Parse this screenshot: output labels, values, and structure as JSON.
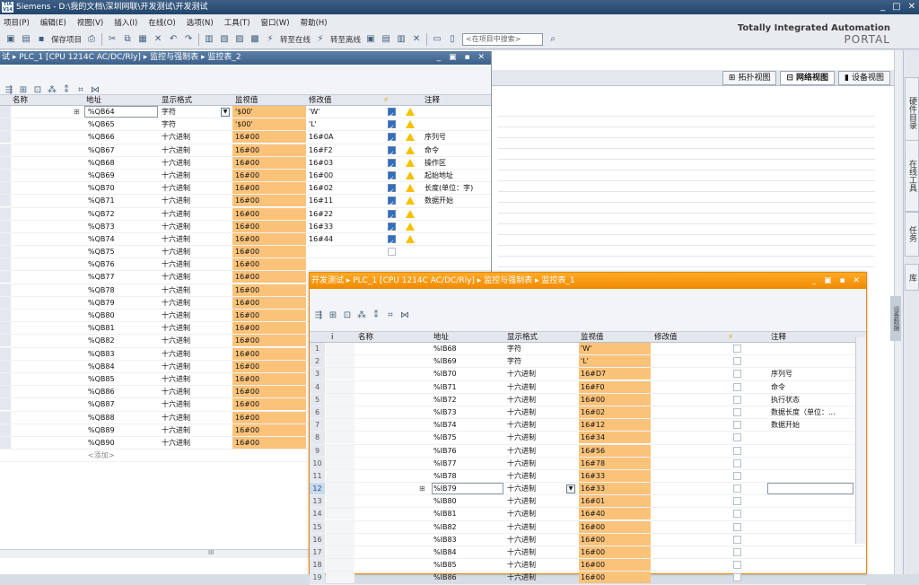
{
  "app": {
    "title": "Siemens  -  D:\\我的文档\\深圳网联\\开发测试\\开发测试",
    "logo": "TIA V14"
  },
  "menu": [
    "项目(P)",
    "编辑(E)",
    "视图(V)",
    "插入(I)",
    "在线(O)",
    "选项(N)",
    "工具(T)",
    "窗口(W)",
    "帮助(H)"
  ],
  "toolbar": {
    "save_project": "保存项目",
    "go_online": "转至在线",
    "go_offline": "转至离线",
    "search_placeholder": "<在项目中搜索>"
  },
  "brand": {
    "line1": "Totally Integrated Automation",
    "line2": "PORTAL"
  },
  "views": [
    "拓扑视图",
    "网络视图",
    "设备视图"
  ],
  "side_tabs": [
    "硬件目录",
    "在线工具",
    "任务",
    "库"
  ],
  "side_tab_small": "设备数据",
  "win1": {
    "title": "试  ▸  PLC_1 [CPU 1214C AC/DC/Rly]  ▸  监控与强制表  ▸  监控表_2",
    "headers": {
      "name": "名称",
      "address": "地址",
      "format": "显示格式",
      "monitor": "监视值",
      "modify": "修改值",
      "comment": "注释"
    },
    "rows": [
      {
        "addr": "%QB64",
        "fmt": "字符",
        "mon": "'$00'",
        "mod": "'W'",
        "chk": true,
        "warn": true,
        "cmt": ""
      },
      {
        "addr": "%QB65",
        "fmt": "字符",
        "mon": "'$00'",
        "mod": "'L'",
        "chk": true,
        "warn": true,
        "cmt": ""
      },
      {
        "addr": "%QB66",
        "fmt": "十六进制",
        "mon": "16#00",
        "mod": "16#0A",
        "chk": true,
        "warn": true,
        "cmt": "序列号"
      },
      {
        "addr": "%QB67",
        "fmt": "十六进制",
        "mon": "16#00",
        "mod": "16#F2",
        "chk": true,
        "warn": true,
        "cmt": "命令"
      },
      {
        "addr": "%QB68",
        "fmt": "十六进制",
        "mon": "16#00",
        "mod": "16#03",
        "chk": true,
        "warn": true,
        "cmt": "操作区"
      },
      {
        "addr": "%QB69",
        "fmt": "十六进制",
        "mon": "16#00",
        "mod": "16#00",
        "chk": true,
        "warn": true,
        "cmt": "起始地址"
      },
      {
        "addr": "%QB70",
        "fmt": "十六进制",
        "mon": "16#00",
        "mod": "16#02",
        "chk": true,
        "warn": true,
        "cmt": "长度(单位：字)"
      },
      {
        "addr": "%QB71",
        "fmt": "十六进制",
        "mon": "16#00",
        "mod": "16#11",
        "chk": true,
        "warn": true,
        "cmt": "数据开始"
      },
      {
        "addr": "%QB72",
        "fmt": "十六进制",
        "mon": "16#00",
        "mod": "16#22",
        "chk": true,
        "warn": true,
        "cmt": ""
      },
      {
        "addr": "%QB73",
        "fmt": "十六进制",
        "mon": "16#00",
        "mod": "16#33",
        "chk": true,
        "warn": true,
        "cmt": ""
      },
      {
        "addr": "%QB74",
        "fmt": "十六进制",
        "mon": "16#00",
        "mod": "16#44",
        "chk": true,
        "warn": true,
        "cmt": ""
      },
      {
        "addr": "%QB75",
        "fmt": "十六进制",
        "mon": "16#00",
        "mod": "",
        "chk": false,
        "warn": false,
        "cmt": ""
      },
      {
        "addr": "%QB76",
        "fmt": "十六进制",
        "mon": "16#00",
        "mod": "",
        "chk": false,
        "warn": false,
        "cmt": ""
      },
      {
        "addr": "%QB77",
        "fmt": "十六进制",
        "mon": "16#00",
        "mod": "",
        "chk": false,
        "warn": false,
        "cmt": ""
      },
      {
        "addr": "%QB78",
        "fmt": "十六进制",
        "mon": "16#00",
        "mod": "",
        "chk": false,
        "warn": false,
        "cmt": ""
      },
      {
        "addr": "%QB79",
        "fmt": "十六进制",
        "mon": "16#00",
        "mod": "",
        "chk": false,
        "warn": false,
        "cmt": ""
      },
      {
        "addr": "%QB80",
        "fmt": "十六进制",
        "mon": "16#00",
        "mod": "",
        "chk": false,
        "warn": false,
        "cmt": ""
      },
      {
        "addr": "%QB81",
        "fmt": "十六进制",
        "mon": "16#00",
        "mod": "",
        "chk": false,
        "warn": false,
        "cmt": ""
      },
      {
        "addr": "%QB82",
        "fmt": "十六进制",
        "mon": "16#00",
        "mod": "",
        "chk": false,
        "warn": false,
        "cmt": ""
      },
      {
        "addr": "%QB83",
        "fmt": "十六进制",
        "mon": "16#00",
        "mod": "",
        "chk": false,
        "warn": false,
        "cmt": ""
      },
      {
        "addr": "%QB84",
        "fmt": "十六进制",
        "mon": "16#00",
        "mod": "",
        "chk": false,
        "warn": false,
        "cmt": ""
      },
      {
        "addr": "%QB85",
        "fmt": "十六进制",
        "mon": "16#00",
        "mod": "",
        "chk": false,
        "warn": false,
        "cmt": ""
      },
      {
        "addr": "%QB86",
        "fmt": "十六进制",
        "mon": "16#00",
        "mod": "",
        "chk": false,
        "warn": false,
        "cmt": ""
      },
      {
        "addr": "%QB87",
        "fmt": "十六进制",
        "mon": "16#00",
        "mod": "",
        "chk": false,
        "warn": false,
        "cmt": ""
      },
      {
        "addr": "%QB88",
        "fmt": "十六进制",
        "mon": "16#00",
        "mod": "",
        "chk": false,
        "warn": false,
        "cmt": ""
      },
      {
        "addr": "%QB89",
        "fmt": "十六进制",
        "mon": "16#00",
        "mod": "",
        "chk": false,
        "warn": false,
        "cmt": ""
      },
      {
        "addr": "%QB90",
        "fmt": "十六进制",
        "mon": "16#00",
        "mod": "",
        "chk": false,
        "warn": false,
        "cmt": ""
      }
    ],
    "add_row": "<添加>",
    "scroll_mark": "III"
  },
  "win2": {
    "title": "开发测试  ▸  PLC_1 [CPU 1214C AC/DC/Rly]  ▸  监控与强制表  ▸  监控表_1",
    "headers": {
      "info": "i",
      "name": "名称",
      "address": "地址",
      "format": "显示格式",
      "monitor": "监视值",
      "modify": "修改值",
      "comment": "注释"
    },
    "rows": [
      {
        "idx": "1",
        "addr": "%IB68",
        "fmt": "字符",
        "mon": "'W'",
        "cmt": ""
      },
      {
        "idx": "2",
        "addr": "%IB69",
        "fmt": "字符",
        "mon": "'L'",
        "cmt": ""
      },
      {
        "idx": "3",
        "addr": "%IB70",
        "fmt": "十六进制",
        "mon": "16#D7",
        "cmt": "序列号"
      },
      {
        "idx": "4",
        "addr": "%IB71",
        "fmt": "十六进制",
        "mon": "16#F0",
        "cmt": "命令"
      },
      {
        "idx": "5",
        "addr": "%IB72",
        "fmt": "十六进制",
        "mon": "16#00",
        "cmt": "执行状态"
      },
      {
        "idx": "6",
        "addr": "%IB73",
        "fmt": "十六进制",
        "mon": "16#02",
        "cmt": "数据长度（单位：..."
      },
      {
        "idx": "7",
        "addr": "%IB74",
        "fmt": "十六进制",
        "mon": "16#12",
        "cmt": "数据开始"
      },
      {
        "idx": "8",
        "addr": "%IB75",
        "fmt": "十六进制",
        "mon": "16#34",
        "cmt": ""
      },
      {
        "idx": "9",
        "addr": "%IB76",
        "fmt": "十六进制",
        "mon": "16#56",
        "cmt": ""
      },
      {
        "idx": "10",
        "addr": "%IB77",
        "fmt": "十六进制",
        "mon": "16#78",
        "cmt": ""
      },
      {
        "idx": "11",
        "addr": "%IB78",
        "fmt": "十六进制",
        "mon": "16#33",
        "cmt": ""
      },
      {
        "idx": "12",
        "addr": "%IB79",
        "fmt": "十六进制",
        "mon": "16#33",
        "cmt": ""
      },
      {
        "idx": "13",
        "addr": "%IB80",
        "fmt": "十六进制",
        "mon": "16#01",
        "cmt": ""
      },
      {
        "idx": "14",
        "addr": "%IB81",
        "fmt": "十六进制",
        "mon": "16#40",
        "cmt": ""
      },
      {
        "idx": "15",
        "addr": "%IB82",
        "fmt": "十六进制",
        "mon": "16#00",
        "cmt": ""
      },
      {
        "idx": "16",
        "addr": "%IB83",
        "fmt": "十六进制",
        "mon": "16#00",
        "cmt": ""
      },
      {
        "idx": "17",
        "addr": "%IB84",
        "fmt": "十六进制",
        "mon": "16#00",
        "cmt": ""
      },
      {
        "idx": "18",
        "addr": "%IB85",
        "fmt": "十六进制",
        "mon": "16#00",
        "cmt": ""
      },
      {
        "idx": "19",
        "addr": "%IB86",
        "fmt": "十六进制",
        "mon": "16#00",
        "cmt": ""
      }
    ]
  },
  "colors": {
    "monitor_bg": "#fbc37a",
    "active_window": "#f08a00",
    "inactive_window": "#3c6089"
  }
}
